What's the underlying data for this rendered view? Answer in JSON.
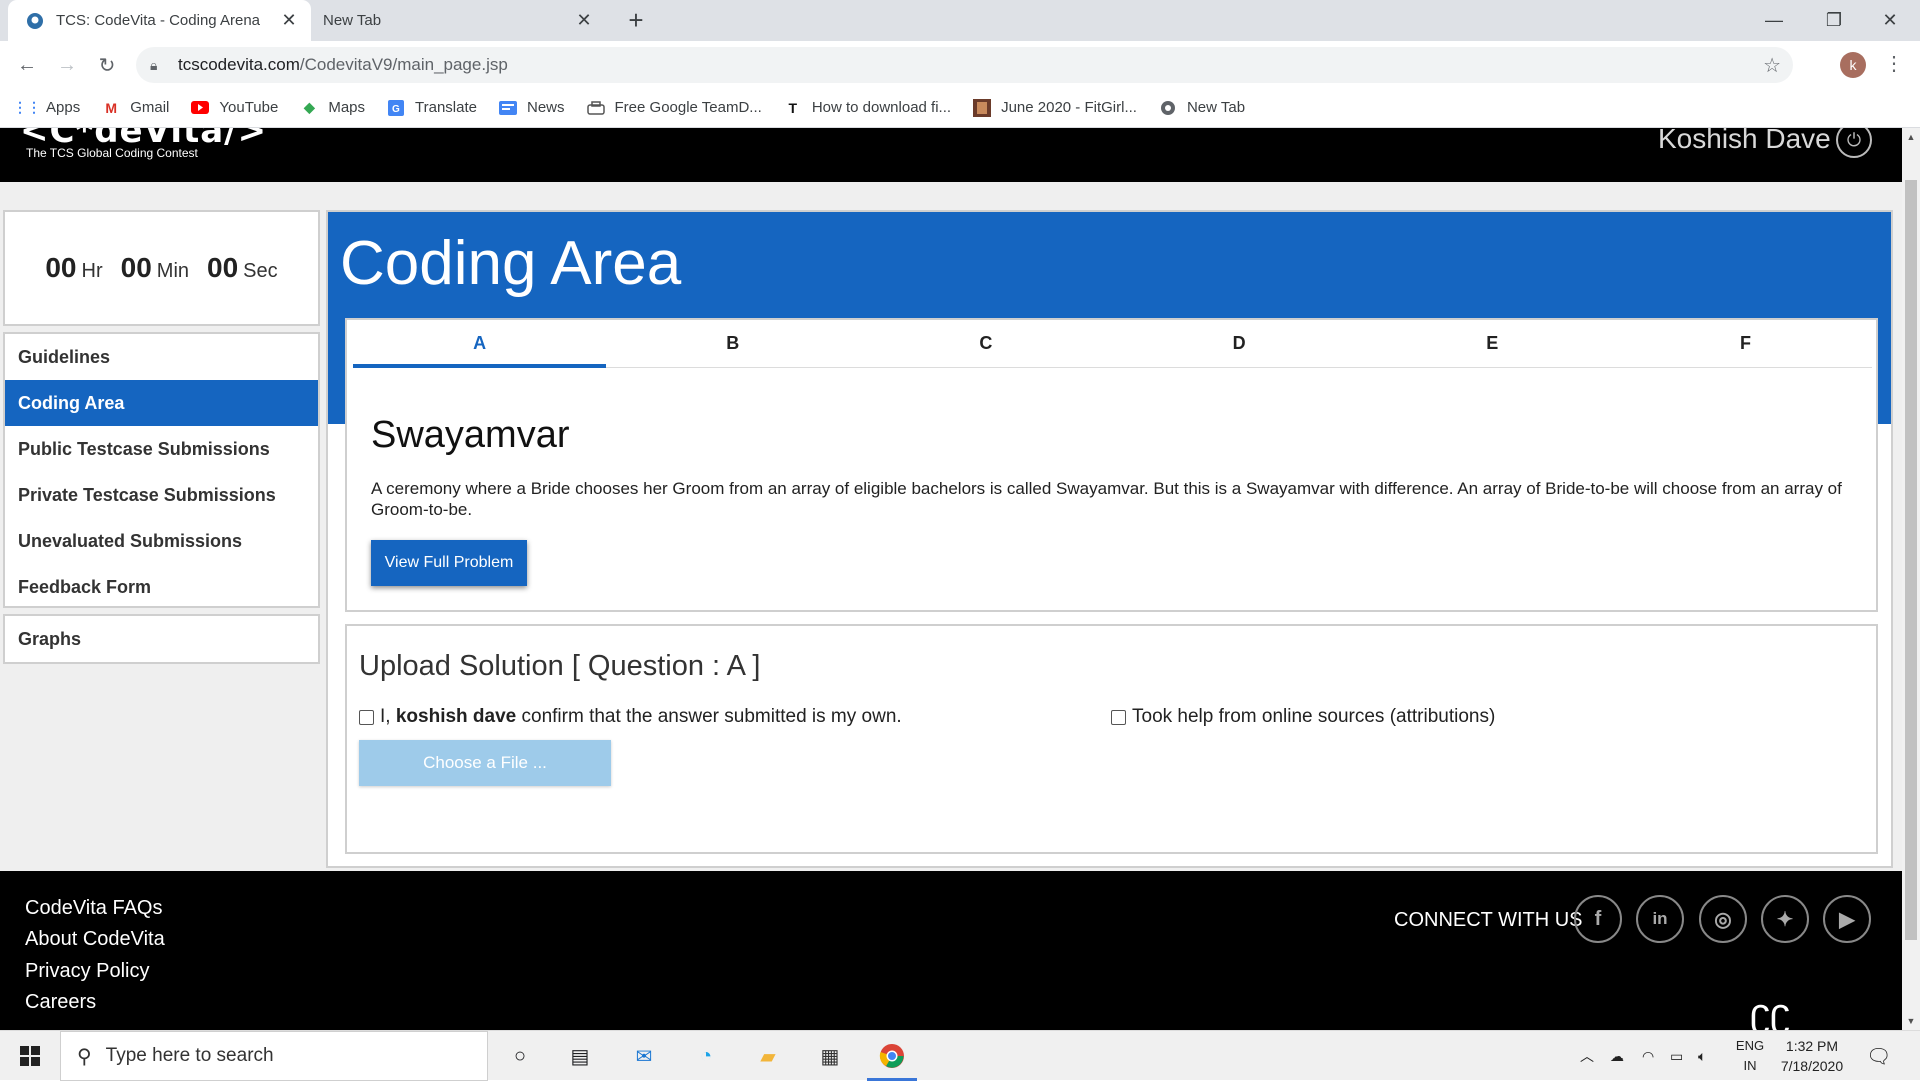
{
  "browser": {
    "tabs": [
      {
        "title": "TCS: CodeVita - Coding Arena",
        "active": true
      },
      {
        "title": "New Tab",
        "active": false
      }
    ],
    "url": {
      "host": "tcscodevita.com",
      "path": "/CodevitaV9/main_page.jsp"
    },
    "profile_initial": "k",
    "bookmarks": [
      {
        "label": "Apps",
        "icon": "apps-grid-icon"
      },
      {
        "label": "Gmail",
        "icon": "gmail-icon"
      },
      {
        "label": "YouTube",
        "icon": "youtube-icon"
      },
      {
        "label": "Maps",
        "icon": "maps-icon"
      },
      {
        "label": "Translate",
        "icon": "translate-icon"
      },
      {
        "label": "News",
        "icon": "news-icon"
      },
      {
        "label": "Free Google TeamD...",
        "icon": "teamdrive-icon"
      },
      {
        "label": "How to download fi...",
        "icon": "t-icon"
      },
      {
        "label": "June 2020 - FitGirl...",
        "icon": "thumbnail-icon"
      },
      {
        "label": "New Tab",
        "icon": "globe-icon"
      }
    ]
  },
  "site": {
    "logo": "<C*deVita/>",
    "tagline": "The TCS Global Coding Contest",
    "user": "Koshish Dave"
  },
  "timer": {
    "hours": "00",
    "hours_label": "Hr",
    "minutes": "00",
    "minutes_label": "Min",
    "seconds": "00",
    "seconds_label": "Sec"
  },
  "sidebar": {
    "items": [
      {
        "label": "Guidelines",
        "active": false
      },
      {
        "label": "Coding Area",
        "active": true
      },
      {
        "label": "Public Testcase Submissions",
        "active": false
      },
      {
        "label": "Private Testcase Submissions",
        "active": false
      },
      {
        "label": "Unevaluated Submissions",
        "active": false
      },
      {
        "label": "Feedback Form",
        "active": false
      }
    ],
    "graphs": "Graphs"
  },
  "main": {
    "title": "Coding Area",
    "question_tabs": [
      "A",
      "B",
      "C",
      "D",
      "E",
      "F"
    ],
    "active_tab": "A",
    "problem": {
      "title": "Swayamvar",
      "description": "A ceremony where a Bride chooses her Groom from an array of eligible bachelors is called Swayamvar. But this is a Swayamvar with difference. An array of Bride-to-be will choose from an array of Groom-to-be.",
      "view_button": "View Full Problem"
    },
    "upload": {
      "title": "Upload Solution [ Question : A ]",
      "confirm_prefix": "I, ",
      "confirm_name": "koshish dave",
      "confirm_suffix": " confirm that the answer submitted is my own.",
      "help_label": "Took help from online sources (attributions)",
      "choose_button": "Choose a File ..."
    }
  },
  "footer": {
    "links": [
      "CodeVita FAQs",
      "About CodeVita",
      "Privacy Policy",
      "Careers"
    ],
    "connect": "CONNECT WITH US",
    "social": [
      "facebook-icon",
      "linkedin-icon",
      "instagram-icon",
      "twitter-icon",
      "youtube-icon"
    ]
  },
  "taskbar": {
    "search_placeholder": "Type here to search",
    "lang_top": "ENG",
    "lang_bottom": "IN",
    "time": "1:32 PM",
    "date": "7/18/2020"
  },
  "colors": {
    "brand_blue": "#1565c0",
    "choose_button": "#9ecbea"
  }
}
